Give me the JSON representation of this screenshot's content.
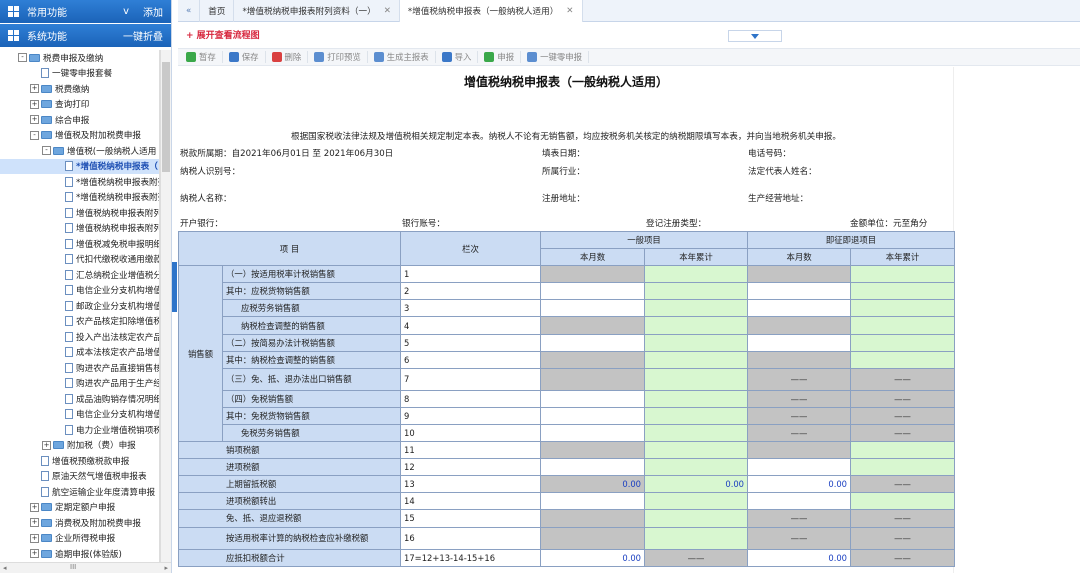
{
  "sidebar": {
    "common": {
      "title": "常用功能",
      "toggle": "v",
      "add": "添加"
    },
    "system": {
      "title": "系统功能",
      "collapse": "一键折叠"
    },
    "tree": [
      {
        "label": "税费申报及缴纳",
        "lvl": 0,
        "kind": "folder",
        "pm": "-"
      },
      {
        "label": "一键零申报套餐",
        "lvl": 1,
        "kind": "page"
      },
      {
        "label": "税费缴纳",
        "lvl": 1,
        "kind": "folder",
        "pm": "+"
      },
      {
        "label": "查询打印",
        "lvl": 1,
        "kind": "folder",
        "pm": "+"
      },
      {
        "label": "综合申报",
        "lvl": 1,
        "kind": "folder",
        "pm": "+"
      },
      {
        "label": "增值税及附加税费申报",
        "lvl": 1,
        "kind": "folder",
        "pm": "-"
      },
      {
        "label": "增值税(一般纳税人适用",
        "lvl": 2,
        "kind": "folder",
        "pm": "-"
      },
      {
        "label": "*增值税纳税申报表（",
        "lvl": 3,
        "kind": "page",
        "sel": true
      },
      {
        "label": "*增值税纳税申报表附列",
        "lvl": 3,
        "kind": "page"
      },
      {
        "label": "*增值税纳税申报表附列",
        "lvl": 3,
        "kind": "page"
      },
      {
        "label": "增值税纳税申报表附列资",
        "lvl": 3,
        "kind": "page"
      },
      {
        "label": "增值税纳税申报表附列资",
        "lvl": 3,
        "kind": "page"
      },
      {
        "label": "增值税减免税申报明细表",
        "lvl": 3,
        "kind": "page"
      },
      {
        "label": "代扣代缴税收通用缴款书",
        "lvl": 3,
        "kind": "page"
      },
      {
        "label": "汇总纳税企业增值税分配",
        "lvl": 3,
        "kind": "page"
      },
      {
        "label": "电信企业分支机构增值税",
        "lvl": 3,
        "kind": "page"
      },
      {
        "label": "邮政企业分支机构增值税",
        "lvl": 3,
        "kind": "page"
      },
      {
        "label": "农产品核定扣除增值税进",
        "lvl": 3,
        "kind": "page"
      },
      {
        "label": "投入产出法核定农产品增",
        "lvl": 3,
        "kind": "page"
      },
      {
        "label": "成本法核定农产品增值税",
        "lvl": 3,
        "kind": "page"
      },
      {
        "label": "购进农产品直接销售核定",
        "lvl": 3,
        "kind": "page"
      },
      {
        "label": "购进农产品用于生产经营",
        "lvl": 3,
        "kind": "page"
      },
      {
        "label": "成品油购销存情况明细表",
        "lvl": 3,
        "kind": "page"
      },
      {
        "label": "电信企业分支机构增值税",
        "lvl": 3,
        "kind": "page"
      },
      {
        "label": "电力企业增值税销项税额",
        "lvl": 3,
        "kind": "page"
      },
      {
        "label": "附加税（费）申报",
        "lvl": 2,
        "kind": "folder",
        "pm": "+"
      },
      {
        "label": "增值税预缴税款申报",
        "lvl": 1,
        "kind": "page"
      },
      {
        "label": "原油天然气增值税申报表",
        "lvl": 1,
        "kind": "page"
      },
      {
        "label": "航空运输企业年度清算申报",
        "lvl": 1,
        "kind": "page"
      },
      {
        "label": "定期定额户申报",
        "lvl": 1,
        "kind": "folder",
        "pm": "+"
      },
      {
        "label": "消费税及附加税费申报",
        "lvl": 1,
        "kind": "folder",
        "pm": "+"
      },
      {
        "label": "企业所得税申报",
        "lvl": 1,
        "kind": "folder",
        "pm": "+"
      },
      {
        "label": "逾期申报(体验版)",
        "lvl": 1,
        "kind": "folder",
        "pm": "+"
      }
    ],
    "hscroll": "III"
  },
  "tabs": {
    "nav": "«",
    "items": [
      {
        "label": "首页",
        "active": false,
        "close": false
      },
      {
        "label": "*增值税纳税申报表附列资料（一）",
        "active": false,
        "close": true
      },
      {
        "label": "*增值税纳税申报表（一般纳税人适用）",
        "active": true,
        "close": true
      }
    ]
  },
  "flow_link": "+ 展开查看流程图",
  "toolbar": [
    {
      "label": "暂存",
      "color": "#3aa84a"
    },
    {
      "label": "保存",
      "color": "#3b78c8"
    },
    {
      "label": "删除",
      "color": "#d94040"
    },
    {
      "label": "打印预览",
      "color": "#5c8ed0"
    },
    {
      "label": "生成主报表",
      "color": "#5c8ed0"
    },
    {
      "label": "导入",
      "color": "#3b78c8"
    },
    {
      "label": "申报",
      "color": "#3aa84a"
    },
    {
      "label": "一键零申报",
      "color": "#5c8ed0"
    }
  ],
  "form": {
    "title": "增值税纳税申报表（一般纳税人适用）",
    "notice": "根据国家税收法律法规及增值税相关规定制定本表。纳税人不论有无销售额，均应按税务机关核定的纳税期限填写本表，并向当地税务机关申报。",
    "fields": {
      "period": "税款所属期：自2021年06月01日 至 2021年06月30日",
      "fill_date": "填表日期：",
      "phone": "电话号码：",
      "taxpayer_id": "纳税人识别号：",
      "industry": "所属行业：",
      "legal_rep": "法定代表人姓名：",
      "taxpayer_name": "纳税人名称：",
      "reg_address": "注册地址：",
      "biz_address": "生产经营地址：",
      "bank": "开户银行：",
      "account": "银行账号：",
      "reg_type": "登记注册类型：",
      "unit": "金额单位：元至角分"
    },
    "header": {
      "item": "项    目",
      "col": "栏次",
      "general": "一般项目",
      "immediate": "即征即退项目",
      "month": "本月数",
      "ytd": "本年累计"
    },
    "category": "销售额",
    "rows": [
      {
        "label": "（一）按适用税率计税销售额",
        "no": "1",
        "c": [
          "g",
          "gn",
          "g",
          "gn"
        ],
        "v": [
          "",
          "",
          "",
          ""
        ]
      },
      {
        "label": "其中：应税货物销售额",
        "no": "2",
        "c": [
          "w",
          "gn",
          "w",
          "gn"
        ],
        "v": [
          "",
          "",
          "",
          ""
        ]
      },
      {
        "label": "应税劳务销售额",
        "no": "3",
        "c": [
          "w",
          "gn",
          "w",
          "gn"
        ],
        "v": [
          "",
          "",
          "",
          ""
        ],
        "indent": true
      },
      {
        "label": "纳税检查调整的销售额",
        "no": "4",
        "c": [
          "g",
          "gn",
          "g",
          "gn"
        ],
        "v": [
          "",
          "",
          "",
          ""
        ],
        "indent": true
      },
      {
        "label": "（二）按简易办法计税销售额",
        "no": "5",
        "c": [
          "w",
          "gn",
          "w",
          "gn"
        ],
        "v": [
          "",
          "",
          "",
          ""
        ]
      },
      {
        "label": "其中：纳税检查调整的销售额",
        "no": "6",
        "c": [
          "g",
          "gn",
          "g",
          "gn"
        ],
        "v": [
          "",
          "",
          "",
          ""
        ]
      },
      {
        "label": "（三）免、抵、退办法出口销售额",
        "no": "7",
        "c": [
          "g",
          "gn",
          "g",
          "g"
        ],
        "v": [
          "",
          "",
          "——",
          "——"
        ],
        "tall": true
      },
      {
        "label": "（四）免税销售额",
        "no": "8",
        "c": [
          "w",
          "gn",
          "g",
          "g"
        ],
        "v": [
          "",
          "",
          "——",
          "——"
        ]
      },
      {
        "label": "其中：免税货物销售额",
        "no": "9",
        "c": [
          "w",
          "gn",
          "g",
          "g"
        ],
        "v": [
          "",
          "",
          "——",
          "——"
        ]
      },
      {
        "label": "免税劳务销售额",
        "no": "10",
        "c": [
          "w",
          "gn",
          "g",
          "g"
        ],
        "v": [
          "",
          "",
          "——",
          "——"
        ],
        "indent": true
      },
      {
        "label": "销项税额",
        "no": "11",
        "c": [
          "g",
          "gn",
          "g",
          "gn"
        ],
        "v": [
          "",
          "",
          "",
          ""
        ]
      },
      {
        "label": "进项税额",
        "no": "12",
        "c": [
          "w",
          "gn",
          "w",
          "gn"
        ],
        "v": [
          "",
          "",
          "",
          ""
        ]
      },
      {
        "label": "上期留抵税额",
        "no": "13",
        "c": [
          "g",
          "gn",
          "w",
          "g"
        ],
        "v": [
          "0.00",
          "0.00",
          "0.00",
          "——"
        ]
      },
      {
        "label": "进项税额转出",
        "no": "14",
        "c": [
          "w",
          "gn",
          "w",
          "gn"
        ],
        "v": [
          "",
          "",
          "",
          ""
        ]
      },
      {
        "label": "免、抵、退应退税额",
        "no": "15",
        "c": [
          "g",
          "gn",
          "g",
          "g"
        ],
        "v": [
          "",
          "",
          "——",
          "——"
        ]
      },
      {
        "label": "按适用税率计算的纳税检查应补缴税额",
        "no": "16",
        "c": [
          "g",
          "gn",
          "g",
          "g"
        ],
        "v": [
          "",
          "",
          "——",
          "——"
        ],
        "tall": true
      },
      {
        "label": "应抵扣税额合计",
        "no": "17=12+13-14-15+16",
        "c": [
          "w",
          "g",
          "w",
          "g"
        ],
        "v": [
          "0.00",
          "——",
          "0.00",
          "——"
        ]
      }
    ]
  }
}
